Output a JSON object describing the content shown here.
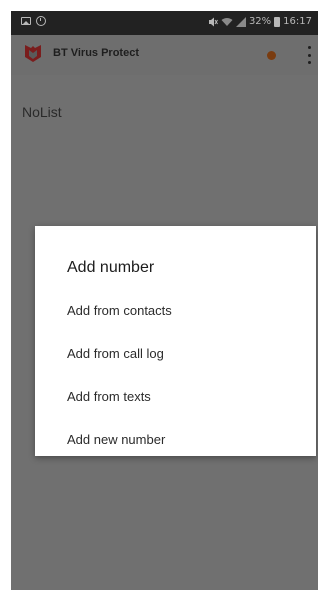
{
  "status_bar": {
    "status_text": "32%",
    "clock": "16:17",
    "icons": [
      "picture-icon",
      "alarm-icon",
      "mute-icon",
      "wifi-icon",
      "signal-icon",
      "battery-icon"
    ]
  },
  "app_bar": {
    "title": "BT Virus Protect",
    "logo_icon": "shield-logo-icon",
    "notification_icon": "notification-dot-icon",
    "menu_icon": "overflow-menu-icon"
  },
  "main": {
    "list_title": "NoList"
  },
  "dialog": {
    "title": "Add number",
    "items": [
      {
        "label": "Add from contacts"
      },
      {
        "label": "Add from call log"
      },
      {
        "label": "Add from texts"
      },
      {
        "label": "Add new number"
      }
    ]
  },
  "colors": {
    "scrim": "#707070",
    "status_bar": "#222222",
    "logo_red": "#7a1d1d",
    "notification_orange": "#7a3c10",
    "dialog_bg": "#ffffff"
  }
}
